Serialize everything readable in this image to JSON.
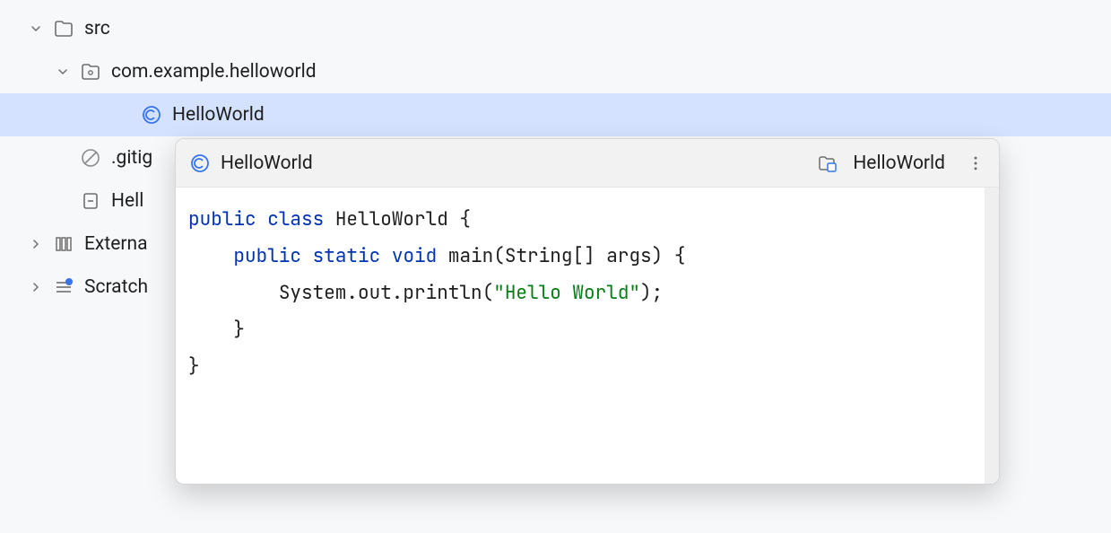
{
  "tree": {
    "src": {
      "label": "src"
    },
    "pkg": {
      "label": "com.example.helloworld"
    },
    "class": {
      "label": "HelloWorld"
    },
    "gitignore": {
      "label": ".gitig"
    },
    "hello_file": {
      "label": "Hell"
    },
    "external": {
      "label": "Externa"
    },
    "scratch": {
      "label": "Scratch"
    }
  },
  "preview": {
    "title": "HelloWorld",
    "context_label": "HelloWorld"
  },
  "code": {
    "l1_kw1": "public",
    "l1_kw2": "class",
    "l1_name": "HelloWorld {",
    "l2_kw1": "public",
    "l2_kw2": "static",
    "l2_kw3": "void",
    "l2_rest": "main(String[] args) {",
    "l3_pre": "System.out.println(",
    "l3_str": "\"Hello World\"",
    "l3_post": ");",
    "l4": "}",
    "l5": "}"
  }
}
